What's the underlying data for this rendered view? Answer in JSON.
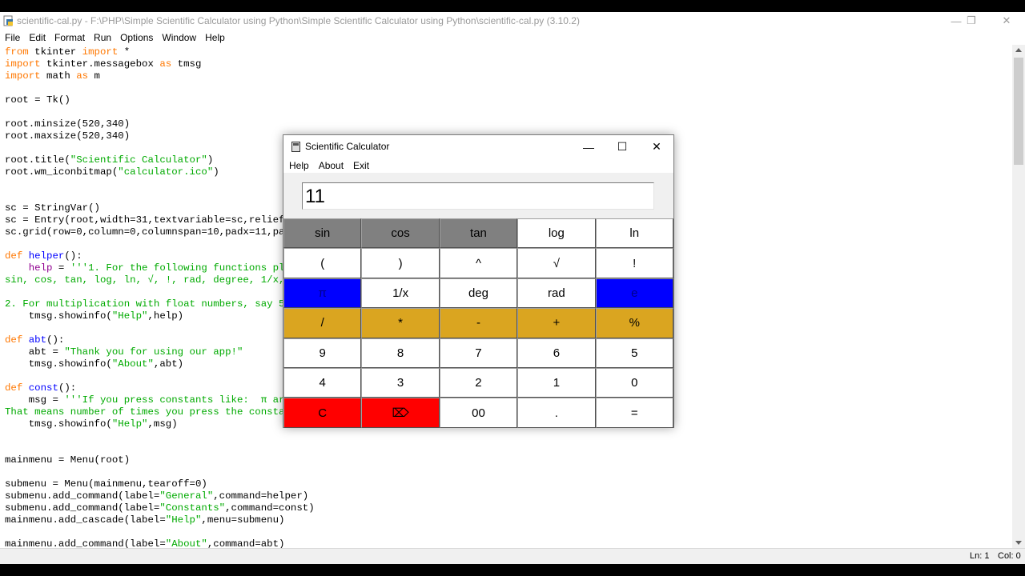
{
  "idle": {
    "title": "scientific-cal.py - F:\\PHP\\Simple Scientific Calculator using Python\\Simple Scientific Calculator using Python\\scientific-cal.py (3.10.2)",
    "menu": [
      "File",
      "Edit",
      "Format",
      "Run",
      "Options",
      "Window",
      "Help"
    ],
    "status": {
      "line": "Ln: 1",
      "col": "Col: 0"
    }
  },
  "calculator": {
    "title": "Scientific Calculator",
    "menu": [
      "Help",
      "About",
      "Exit"
    ],
    "display": "11",
    "keys": [
      [
        "sin",
        "cos",
        "tan",
        "log",
        "ln"
      ],
      [
        "(",
        ")",
        "^",
        "√",
        "!"
      ],
      [
        "π",
        "1/x",
        "deg",
        "rad",
        "e"
      ],
      [
        "/",
        "*",
        "-",
        "+",
        "%"
      ],
      [
        "9",
        "8",
        "7",
        "6",
        "5"
      ],
      [
        "4",
        "3",
        "2",
        "1",
        "0"
      ],
      [
        "C",
        "⌦",
        "00",
        ".",
        "="
      ]
    ],
    "colors": {
      "gray": "#808080",
      "blue": "#0000ff",
      "gold": "#daa520",
      "red": "#ff0000",
      "white": "#ffffff"
    }
  },
  "code_lines": [
    "from tkinter import *",
    "import tkinter.messagebox as tmsg",
    "import math as m",
    "",
    "root = Tk()",
    "",
    "root.minsize(520,340)",
    "root.maxsize(520,340)",
    "",
    "root.title(\"Scientific Calculator\")",
    "root.wm_iconbitmap(\"calculator.ico\")",
    "",
    "",
    "sc = StringVar()",
    "sc = Entry(root,width=31,textvariable=sc,relief=",
    "sc.grid(row=0,column=0,columnspan=10,padx=11,pa",
    "",
    "def helper():",
    "    help = '''1. For the following functions pl",
    "sin, cos, tan, log, ln, √, !, rad, degree, 1/x,",
    "",
    "2. For multiplication with float numbers, say 5",
    "    tmsg.showinfo(\"Help\",help)",
    "",
    "def abt():",
    "    abt = \"Thank you for using our app!\"",
    "    tmsg.showinfo(\"About\",abt)",
    "",
    "def const():",
    "    msg = '''If you press constants like:  π ar",
    "That means number of times you press the consta",
    "    tmsg.showinfo(\"Help\",msg)",
    "",
    "",
    "mainmenu = Menu(root)",
    "",
    "submenu = Menu(mainmenu,tearoff=0)",
    "submenu.add_command(label=\"General\",command=helper)",
    "submenu.add_command(label=\"Constants\",command=const)",
    "mainmenu.add_cascade(label=\"Help\",menu=submenu)",
    "",
    "mainmenu.add_command(label=\"About\",command=abt)"
  ]
}
